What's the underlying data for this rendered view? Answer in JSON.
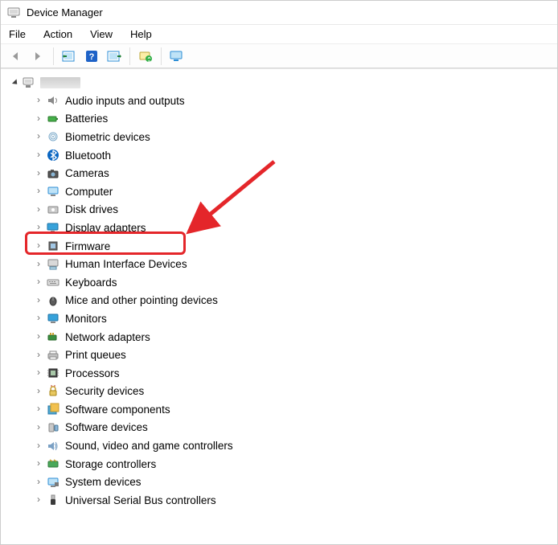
{
  "window": {
    "title": "Device Manager"
  },
  "menu": {
    "items": [
      "File",
      "Action",
      "View",
      "Help"
    ]
  },
  "toolbar": {
    "back": "back-arrow",
    "forward": "forward-arrow",
    "show_hidden": "show-hidden",
    "help": "help",
    "action": "action-properties",
    "scan": "scan-hardware",
    "monitor": "monitor"
  },
  "tree": {
    "root": {
      "label": ""
    },
    "categories": [
      {
        "icon": "speaker",
        "label": "Audio inputs and outputs"
      },
      {
        "icon": "battery",
        "label": "Batteries"
      },
      {
        "icon": "fingerprint",
        "label": "Biometric devices"
      },
      {
        "icon": "bluetooth",
        "label": "Bluetooth"
      },
      {
        "icon": "camera",
        "label": "Cameras"
      },
      {
        "icon": "computer",
        "label": "Computer"
      },
      {
        "icon": "disk",
        "label": "Disk drives"
      },
      {
        "icon": "display",
        "label": "Display adapters",
        "highlighted": true
      },
      {
        "icon": "firmware",
        "label": "Firmware"
      },
      {
        "icon": "hid",
        "label": "Human Interface Devices"
      },
      {
        "icon": "keyboard",
        "label": "Keyboards"
      },
      {
        "icon": "mouse",
        "label": "Mice and other pointing devices"
      },
      {
        "icon": "monitor",
        "label": "Monitors"
      },
      {
        "icon": "network",
        "label": "Network adapters"
      },
      {
        "icon": "printer",
        "label": "Print queues"
      },
      {
        "icon": "cpu",
        "label": "Processors"
      },
      {
        "icon": "security",
        "label": "Security devices"
      },
      {
        "icon": "swcomp",
        "label": "Software components"
      },
      {
        "icon": "swdev",
        "label": "Software devices"
      },
      {
        "icon": "sound",
        "label": "Sound, video and game controllers"
      },
      {
        "icon": "storage",
        "label": "Storage controllers"
      },
      {
        "icon": "system",
        "label": "System devices"
      },
      {
        "icon": "usb",
        "label": "Universal Serial Bus controllers"
      }
    ]
  },
  "annotation": {
    "highlight_target": "Display adapters",
    "highlight_color": "#e4262a",
    "arrow_color": "#e4262a"
  }
}
